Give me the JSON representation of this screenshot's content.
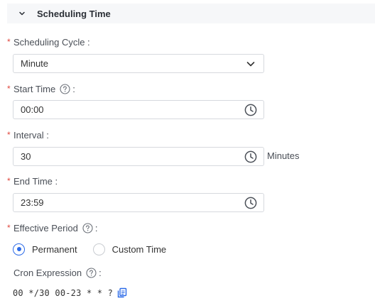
{
  "section": {
    "title": "Scheduling Time"
  },
  "fields": {
    "scheduling_cycle": {
      "label": "Scheduling Cycle :",
      "value": "Minute"
    },
    "start_time": {
      "label": "Start Time",
      "colon": ":",
      "value": "00:00"
    },
    "interval": {
      "label": "Interval :",
      "value": "30",
      "suffix": "Minutes"
    },
    "end_time": {
      "label": "End Time :",
      "value": "23:59"
    },
    "effective_period": {
      "label": "Effective Period",
      "colon": ":",
      "options": [
        {
          "label": "Permanent",
          "checked": true
        },
        {
          "label": "Custom Time",
          "checked": false
        }
      ]
    },
    "cron": {
      "label": "Cron Expression",
      "colon": ":",
      "value": "00 */30 00-23 * * ?"
    }
  },
  "colors": {
    "accent": "#2b6ae8",
    "required": "#e0483f",
    "header_bg": "#f6f7f9",
    "border": "#d6d9de"
  },
  "icons": {
    "header": "chevron-down-icon",
    "select": "chevron-down-icon",
    "time": "clock-icon",
    "help": "help-circle-icon",
    "copy": "copy-icon"
  }
}
